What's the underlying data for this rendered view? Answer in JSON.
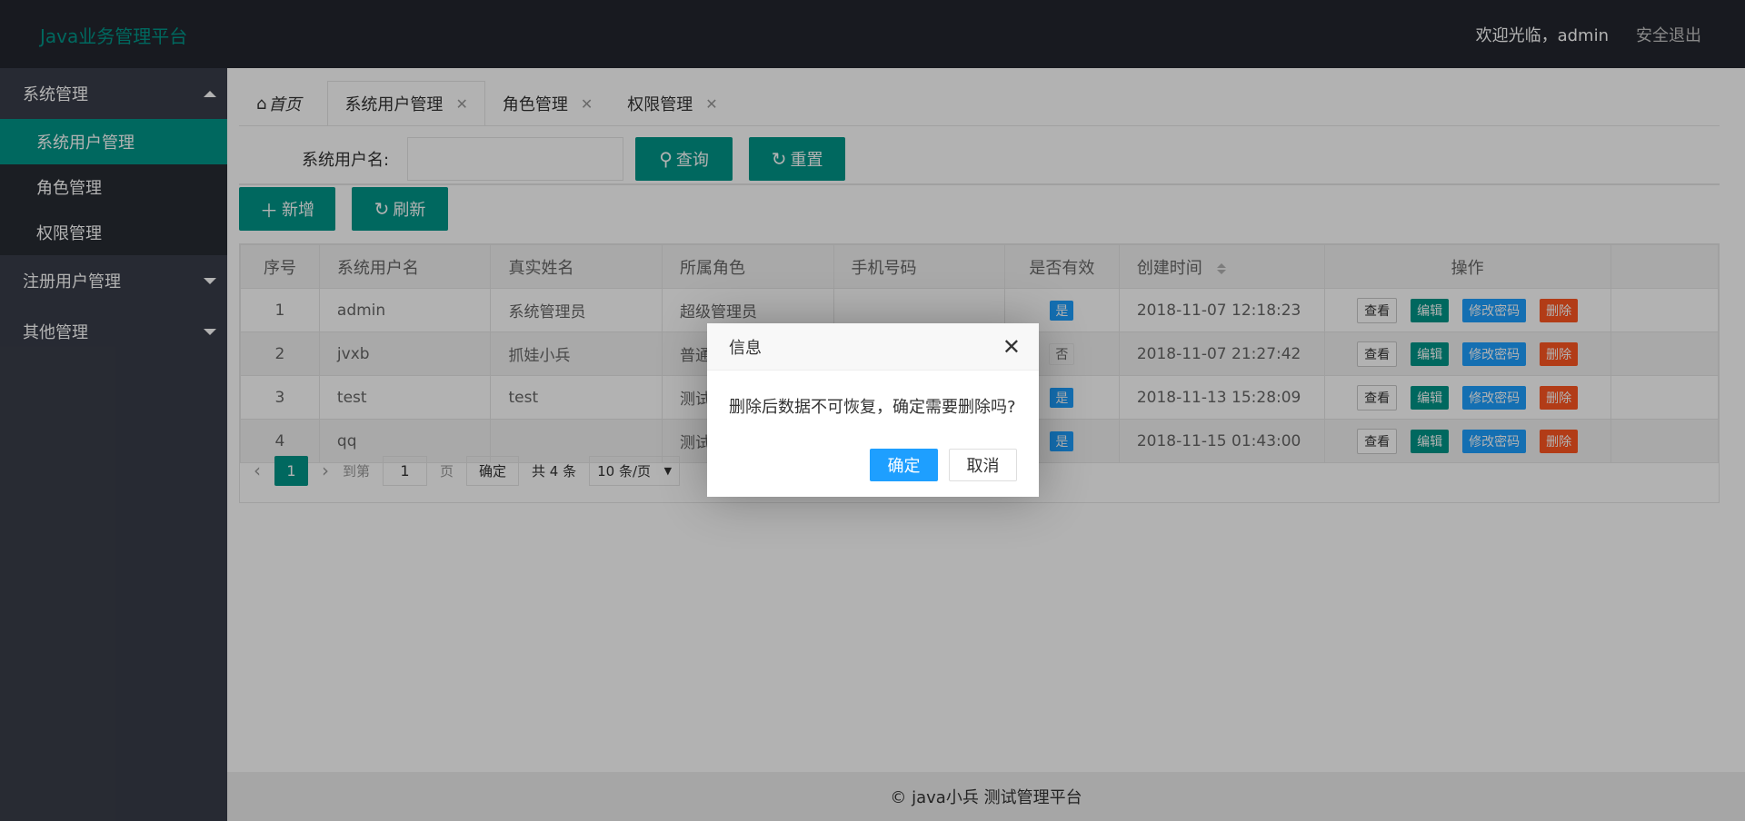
{
  "header": {
    "logo": "Java业务管理平台",
    "welcome": "欢迎光临，admin",
    "logout": "安全退出"
  },
  "sidebar": {
    "groups": [
      {
        "label": "系统管理",
        "expanded": true,
        "items": [
          "系统用户管理",
          "角色管理",
          "权限管理"
        ]
      },
      {
        "label": "注册用户管理",
        "expanded": false
      },
      {
        "label": "其他管理",
        "expanded": false
      }
    ],
    "active_item": "系统用户管理"
  },
  "tabs": [
    {
      "label": "首页",
      "icon": "home-icon",
      "closable": false
    },
    {
      "label": "系统用户管理",
      "closable": true,
      "active": true
    },
    {
      "label": "角色管理",
      "closable": true
    },
    {
      "label": "权限管理",
      "closable": true
    }
  ],
  "search": {
    "label": "系统用户名:",
    "value": "",
    "search_button": "查询",
    "reset_button": "重置"
  },
  "actions": {
    "add_button": "新增",
    "refresh_button": "刷新"
  },
  "table": {
    "columns": [
      "序号",
      "系统用户名",
      "真实姓名",
      "所属角色",
      "手机号码",
      "是否有效",
      "创建时间",
      "操作"
    ],
    "rows": [
      {
        "no": "1",
        "username": "admin",
        "realname": "系统管理员",
        "role": "超级管理员",
        "phone": "",
        "valid": "是",
        "created": "2018-11-07 12:18:23"
      },
      {
        "no": "2",
        "username": "jvxb",
        "realname": "抓娃小兵",
        "role": "普通",
        "phone": "",
        "valid": "否",
        "created": "2018-11-07 21:27:42"
      },
      {
        "no": "3",
        "username": "test",
        "realname": "test",
        "role": "测试",
        "phone": "",
        "valid": "是",
        "created": "2018-11-13 15:28:09"
      },
      {
        "no": "4",
        "username": "qq",
        "realname": "",
        "role": "测试",
        "phone": "",
        "valid": "是",
        "created": "2018-11-15 01:43:00"
      }
    ],
    "row_actions": {
      "view": "查看",
      "edit": "编辑",
      "password": "修改密码",
      "delete": "删除"
    }
  },
  "pager": {
    "current": "1",
    "goto_label": "到第",
    "goto_value": "1",
    "page_suffix": "页",
    "ok": "确定",
    "total": "共 4 条",
    "page_size": "10 条/页"
  },
  "footer": {
    "text": "© java小兵 测试管理平台"
  },
  "dialog": {
    "title": "信息",
    "message": "删除后数据不可恢复，确定需要删除吗?",
    "ok": "确定",
    "cancel": "取消"
  },
  "colors": {
    "header_bg": "#23262e",
    "sidebar_bg": "#393d49",
    "accent": "#009688",
    "blue": "#1e9fff",
    "danger": "#ff5722"
  }
}
